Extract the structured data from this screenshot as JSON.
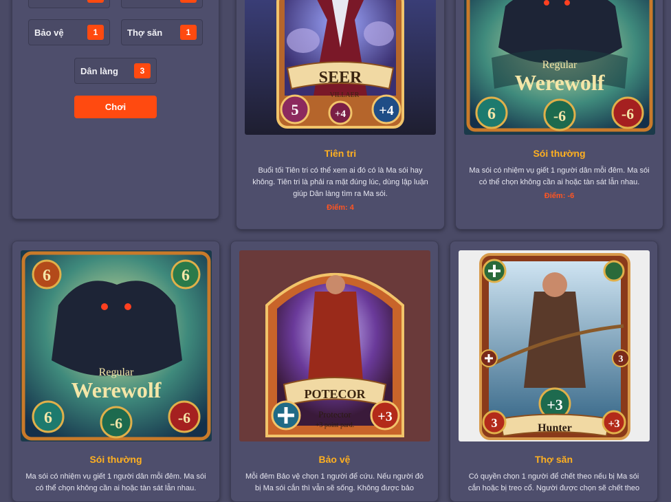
{
  "role_counts": [
    {
      "label": "Bảo vệ",
      "count": "1"
    },
    {
      "label": "Thợ săn",
      "count": "1"
    },
    {
      "label": "Dân làng",
      "count": "3"
    }
  ],
  "play_button": "Chơi",
  "cards": [
    {
      "title": "Tiên tri",
      "description": "Buổi tối Tiên tri có thể xem ai đó có là Ma sói hay không. Tiên tri là phải ra mặt đúng lúc, dùng lập luận giúp Dân làng tìm ra Ma sói.",
      "score": "Điểm: 4",
      "art": {
        "banner": "SEER",
        "sub": "VILLAER",
        "left": "5",
        "mid": "+4",
        "right": "+4"
      }
    },
    {
      "title": "Sói thường",
      "description": "Ma sói có nhiệm vụ giết 1 người dân mỗi đêm. Ma sói có thể chọn không cần ai hoặc tàn sát lẫn nhau.",
      "score": "Điểm: -6",
      "art": {
        "line1": "Regular",
        "line2": "Werewolf",
        "n1": "6",
        "n2": "-6",
        "n3": "-6"
      }
    },
    {
      "title": "Sói thường",
      "description": "Ma sói có nhiệm vụ giết 1 người dân mỗi đêm. Ma sói có thể chọn không cần ai hoặc tàn sát lẫn nhau.",
      "art": {
        "line1": "Regular",
        "line2": "Werewolf",
        "n1": "6",
        "n2": "-6",
        "n3": "-6",
        "tl": "6",
        "tr": "6"
      }
    },
    {
      "title": "Bảo vệ",
      "description": "Mỗi đêm Bảo vệ chọn 1 người để cứu. Nếu người đó bị Ma sói cắn thì vẫn sẽ sống. Không được bảo",
      "art": {
        "banner": "POTECOR",
        "sub1": "Protector",
        "sub2": "+3 point pard.",
        "right": "+3"
      }
    },
    {
      "title": "Thợ săn",
      "description": "Có quyền chọn 1 người để chết theo nếu bị Ma sói cắn hoặc bị treo cổ. Người được chọn sẽ chết theo",
      "art": {
        "banner": "Hunter",
        "mid": "+3",
        "l": "3",
        "r": "+3",
        "rm": "3"
      }
    }
  ]
}
